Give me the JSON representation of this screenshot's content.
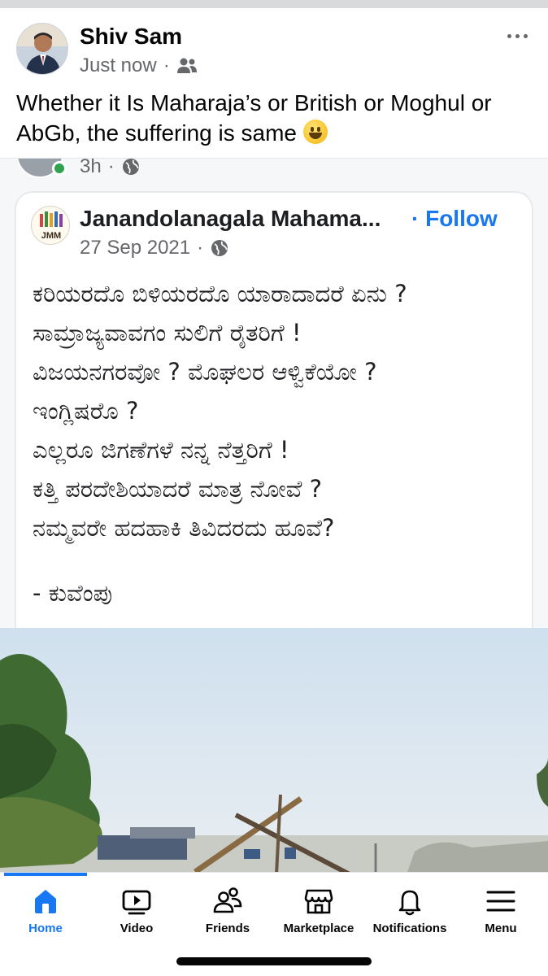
{
  "post": {
    "author": "Shiv Sam",
    "time": "Just now",
    "separator": "·",
    "audience_icon": "friends-icon",
    "more_icon": "more-dots-icon",
    "text": "Whether it Is Maharaja’s or British or Moghul or AbGb, the suffering is same",
    "emoji": "grinning-face-emoji"
  },
  "shared": {
    "partial_time": "3h",
    "separator": "·",
    "privacy_icon": "globe-icon",
    "card": {
      "page_name": "Janandolanagala Mahama...",
      "follow_label": "· Follow",
      "logo_text": "JMM",
      "date": "27 Sep 2021",
      "separator": "·",
      "poem_lines": [
        "ಕರಿಯರದೊ ಬಿಳಿಯರದೊ ಯಾರಾದಾದರೆ ಏನು ?",
        "ಸಾಮ್ರಾಜ್ಯವಾವಗಂ ಸುಲಿಗೆ ರೈತರಿಗೆ !",
        "ವಿಜಯನಗರವೋ ? ಮೊಘಲರ ಆಳ್ವಿಕೆಯೋ ?",
        "ಇಂಗ್ಲಿಷರೊ ?",
        "ಎಲ್ಲರೂ ಜಿಗಣೆಗಳೆ ನನ್ನ ನೆತ್ತರಿಗೆ !",
        "ಕತ್ತಿ ಪರದೇಶಿಯಾದರೆ ಮಾತ್ರ ನೋವೆ ?",
        "ನಮ್ಮವರೇ ಹದಹಾಕಿ ತಿವಿದರದು ಹೂವೆ?"
      ],
      "signature": "- ಕುವೆಂಪು"
    }
  },
  "nav": {
    "items": [
      {
        "label": "Home",
        "icon": "home-icon",
        "active": true
      },
      {
        "label": "Video",
        "icon": "video-icon",
        "active": false
      },
      {
        "label": "Friends",
        "icon": "friends-icon",
        "active": false
      },
      {
        "label": "Marketplace",
        "icon": "marketplace-icon",
        "active": false
      },
      {
        "label": "Notifications",
        "icon": "bell-icon",
        "active": false
      },
      {
        "label": "Menu",
        "icon": "menu-icon",
        "active": false
      }
    ],
    "active_color": "#1877f2"
  }
}
